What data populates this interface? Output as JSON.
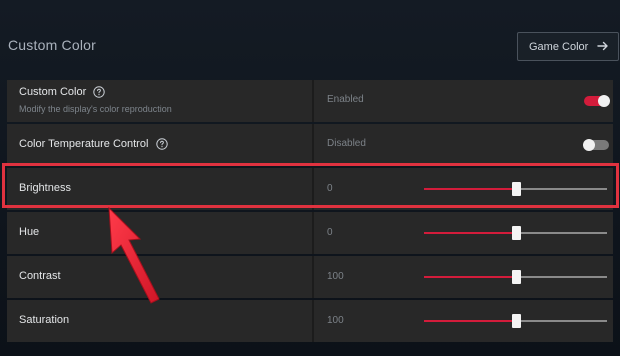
{
  "section": {
    "title": "Custom Color"
  },
  "game_color_button": {
    "label": "Game Color",
    "icon": "arrow-right-icon"
  },
  "rows": [
    {
      "label": "Custom Color",
      "sub": "Modify the display's color reproduction",
      "value": "Enabled",
      "help": true,
      "control": "toggle",
      "state": "on"
    },
    {
      "label": "Color Temperature Control",
      "value": "Disabled",
      "help": true,
      "control": "toggle",
      "state": "off"
    },
    {
      "label": "Brightness",
      "value": "0",
      "control": "slider",
      "level": 0.5
    },
    {
      "label": "Hue",
      "value": "0",
      "control": "slider",
      "level": 0.5
    },
    {
      "label": "Contrast",
      "value": "100",
      "control": "slider",
      "level": 0.5
    },
    {
      "label": "Saturation",
      "value": "100",
      "control": "slider",
      "level": 0.5
    }
  ],
  "colors": {
    "accent": "#d31c3b",
    "highlight": "#e0323f",
    "row_bg": "#282828",
    "track": "#8a8a8a"
  }
}
